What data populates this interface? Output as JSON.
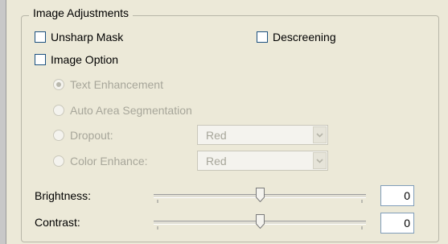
{
  "group": {
    "title": "Image Adjustments"
  },
  "checkboxes": {
    "unsharp_mask": {
      "label": "Unsharp Mask",
      "checked": false
    },
    "descreening": {
      "label": "Descreening",
      "checked": false
    },
    "image_option": {
      "label": "Image Option",
      "checked": false
    }
  },
  "radios": {
    "text_enhancement": {
      "label": "Text Enhancement",
      "selected": true,
      "disabled": true
    },
    "auto_area_segmentation": {
      "label": "Auto Area Segmentation",
      "selected": false,
      "disabled": true
    },
    "dropout": {
      "label": "Dropout:",
      "selected": false,
      "disabled": true
    },
    "color_enhance": {
      "label": "Color Enhance:",
      "selected": false,
      "disabled": true
    }
  },
  "selects": {
    "dropout": {
      "value": "Red",
      "disabled": true
    },
    "color_enhance": {
      "value": "Red",
      "disabled": true
    }
  },
  "brightness": {
    "label": "Brightness:",
    "value": "0",
    "min": -100,
    "max": 100,
    "position": 0
  },
  "contrast": {
    "label": "Contrast:",
    "value": "0",
    "min": -100,
    "max": 100,
    "position": 0
  },
  "colors": {
    "accent": "#1c5180",
    "disabled_text": "#a7a69a",
    "background": "#ece9d8"
  }
}
